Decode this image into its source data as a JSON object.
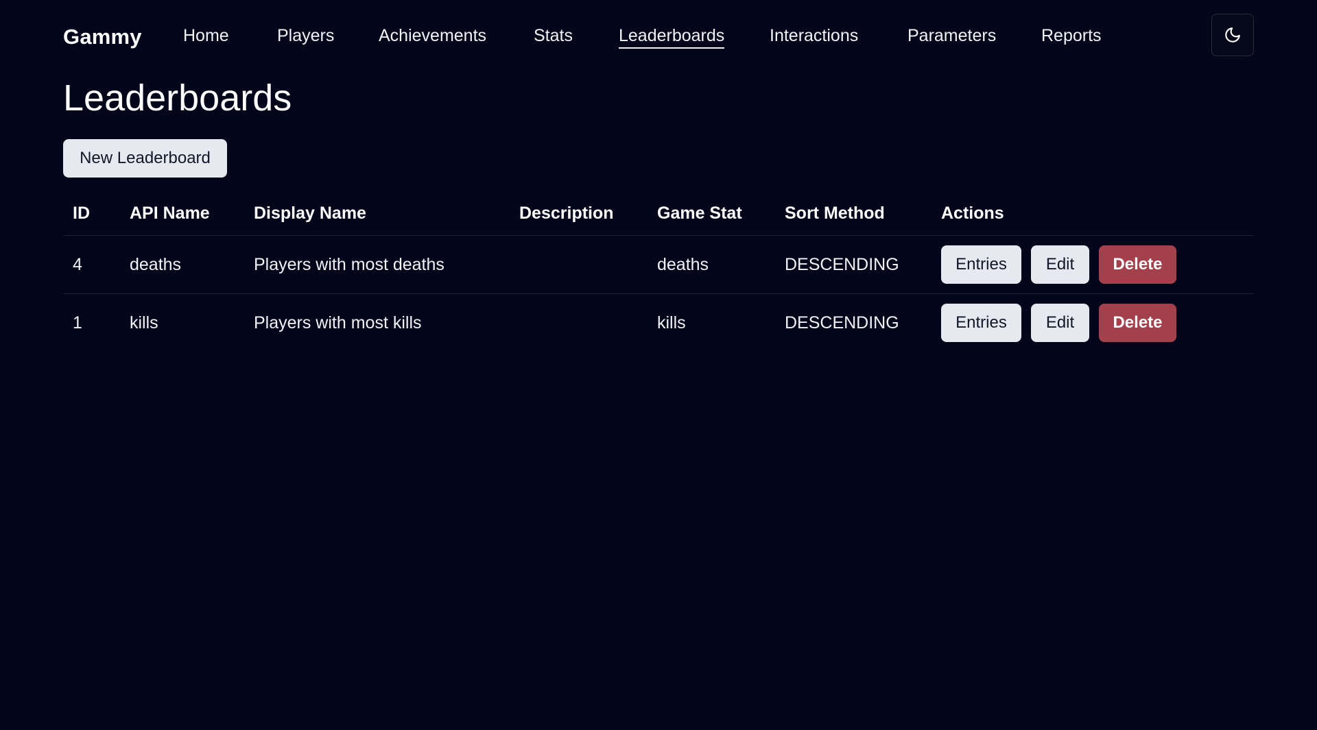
{
  "nav": {
    "brand": "Gammy",
    "links": [
      {
        "label": "Home"
      },
      {
        "label": "Players"
      },
      {
        "label": "Achievements"
      },
      {
        "label": "Stats"
      },
      {
        "label": "Leaderboards",
        "active": true
      },
      {
        "label": "Interactions"
      },
      {
        "label": "Parameters"
      },
      {
        "label": "Reports"
      }
    ],
    "theme_toggle_icon": "moon-icon"
  },
  "page": {
    "title": "Leaderboards",
    "new_button_label": "New Leaderboard"
  },
  "table": {
    "headers": [
      "ID",
      "API Name",
      "Display Name",
      "Description",
      "Game Stat",
      "Sort Method",
      "Actions"
    ],
    "rows": [
      {
        "id": "4",
        "api_name": "deaths",
        "display_name": "Players with most deaths",
        "description": "",
        "game_stat": "deaths",
        "sort_method": "DESCENDING"
      },
      {
        "id": "1",
        "api_name": "kills",
        "display_name": "Players with most kills",
        "description": "",
        "game_stat": "kills",
        "sort_method": "DESCENDING"
      }
    ],
    "actions": {
      "entries_label": "Entries",
      "edit_label": "Edit",
      "delete_label": "Delete"
    }
  },
  "colors": {
    "background": "#03061a",
    "text": "#f1f3f8",
    "button_light": "#e6e9f0",
    "button_danger": "#a3404c"
  }
}
